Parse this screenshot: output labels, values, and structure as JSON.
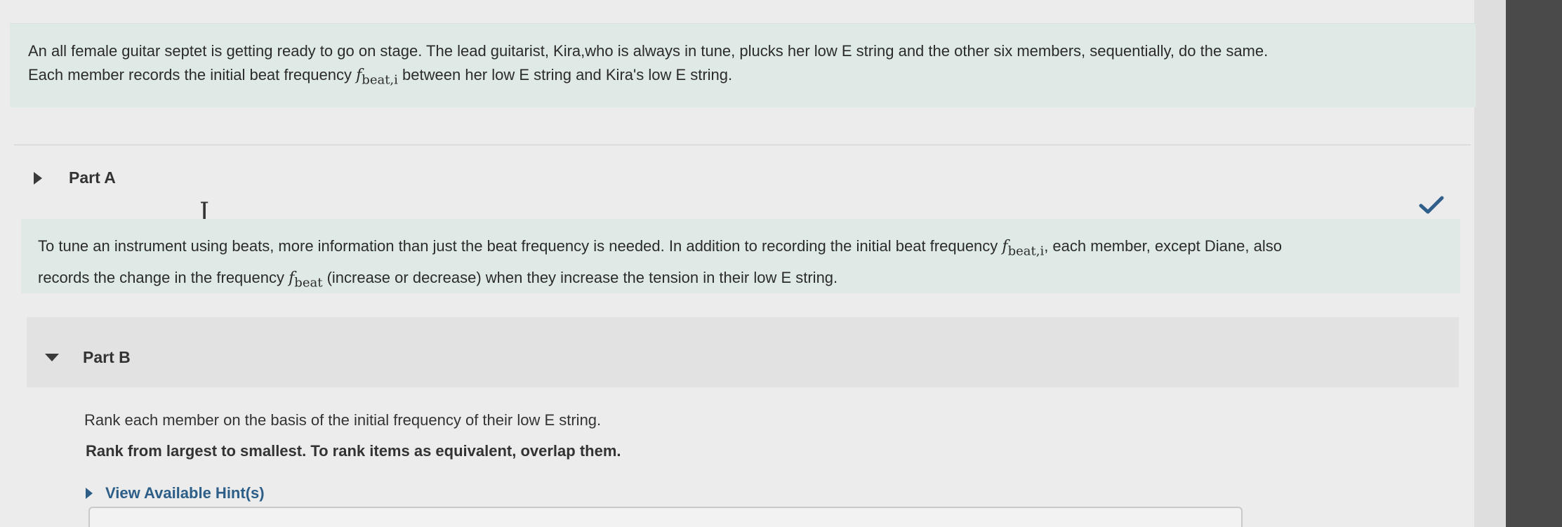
{
  "intro": {
    "line1": "An all female guitar septet is getting ready to go on stage. The lead guitarist, Kira,who is always in tune, plucks her low E string and the other six members, sequentially, do the same.",
    "line2_before": "Each member records the initial beat frequency",
    "line2_symbol": "f",
    "line2_sub": "beat,i",
    "line2_after": "between her low E string and Kira's low E string."
  },
  "partA": {
    "title": "Part A",
    "status_icon": "checkmark-icon",
    "status_color": "#2f5f8a"
  },
  "context": {
    "text_before": "To tune an instrument using beats, more information than just the beat frequency is needed. In addition to recording the initial beat frequency",
    "symbol1": "f",
    "sub1": "beat,i",
    "text_middle": ", each member, except Diane, also",
    "line2_before": "records the change in the frequency",
    "symbol2": "f",
    "sub2": "beat",
    "text_after": "(increase or decrease) when they increase the tension in their low E string."
  },
  "partB": {
    "title": "Part B",
    "question": "Rank each member on the basis of the initial frequency of their low E string.",
    "instruction": "Rank from largest to smallest. To rank items as equivalent, overlap them.",
    "hint_label": "View Available Hint(s)"
  }
}
